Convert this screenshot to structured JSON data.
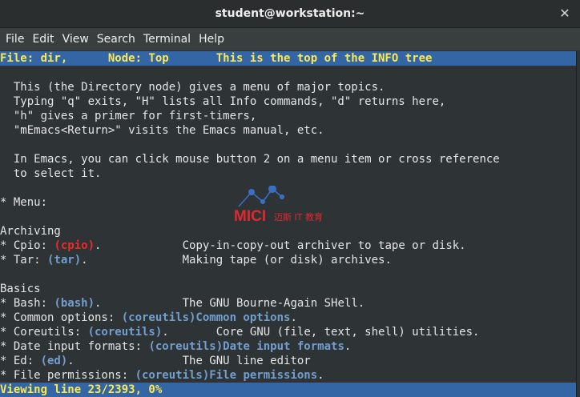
{
  "window": {
    "title": "student@workstation:~"
  },
  "menu": [
    "File",
    "Edit",
    "View",
    "Search",
    "Terminal",
    "Help"
  ],
  "header": "File: dir,      Node: Top       This is the top of the INFO tree",
  "intro": [
    "  This (the Directory node) gives a menu of major topics.",
    "  Typing \"q\" exits, \"H\" lists all Info commands, \"d\" returns here,",
    "  \"h\" gives a primer for first-timers,",
    "  \"mEmacs<Return>\" visits the Emacs manual, etc."
  ],
  "emacs": [
    "  In Emacs, you can click mouse button 2 on a menu item or cross reference",
    "  to select it."
  ],
  "menu_label": "* Menu:",
  "archiving": {
    "title": "Archiving",
    "items": [
      {
        "prefix": "* Cpio: ",
        "ref": "(cpio)",
        "suffix": ".",
        "pad": "            ",
        "desc": "Copy-in-copy-out archiver to tape or disk."
      },
      {
        "prefix": "* Tar: ",
        "ref": "(tar)",
        "suffix": ".",
        "pad": "              ",
        "desc": "Making tape (or disk) archives."
      }
    ]
  },
  "basics": {
    "title": "Basics",
    "items": [
      {
        "prefix": "* Bash: ",
        "ref": "(bash)",
        "suffix": ".",
        "pad": "            ",
        "desc": "The GNU Bourne-Again SHell."
      },
      {
        "prefix": "* Common options: ",
        "ref": "(coreutils)Common options",
        "suffix": ".",
        "pad": "",
        "desc": ""
      },
      {
        "prefix": "* Coreutils: ",
        "ref": "(coreutils)",
        "suffix": ".",
        "pad": "       ",
        "desc": "Core GNU (file, text, shell) utilities."
      },
      {
        "prefix": "* Date input formats: ",
        "ref": "(coreutils)Date input formats",
        "suffix": ".",
        "pad": "",
        "desc": ""
      },
      {
        "prefix": "* Ed: ",
        "ref": "(ed)",
        "suffix": ".",
        "pad": "                ",
        "desc": "The GNU line editor"
      },
      {
        "prefix": "* File permissions: ",
        "ref": "(coreutils)File permissions",
        "suffix": ".",
        "pad": "",
        "desc": ""
      }
    ]
  },
  "status": "Viewing line 23/2393, 0%",
  "watermark": {
    "text": "MICI",
    "subtext": "迈斯 IT 教育"
  }
}
